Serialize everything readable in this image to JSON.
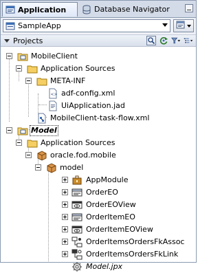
{
  "tabs": [
    {
      "label": "Application",
      "icon": "application-icon",
      "active": true
    },
    {
      "label": "Database Navigator",
      "icon": "database-navigator-icon",
      "active": false
    }
  ],
  "app_selector": {
    "value": "SampleApp",
    "icon": "application-icon"
  },
  "projects_panel": {
    "title": "Projects"
  },
  "tree": [
    {
      "label": "MobileClient",
      "icon": "project-folder-icon",
      "expanded": true
    },
    {
      "label": "Application Sources",
      "icon": "folder-icon",
      "expanded": true
    },
    {
      "label": "META-INF",
      "icon": "folder-icon",
      "expanded": true
    },
    {
      "label": "adf-config.xml",
      "icon": "xml-file-icon"
    },
    {
      "label": "UiApplication.jad",
      "icon": "jad-file-icon"
    },
    {
      "label": "MobileClient-task-flow.xml",
      "icon": "task-flow-icon"
    },
    {
      "label": "Model",
      "icon": "project-folder-icon",
      "expanded": true,
      "selected": true
    },
    {
      "label": "Application Sources",
      "icon": "folder-icon",
      "expanded": true
    },
    {
      "label": "oracle.fod.mobile",
      "icon": "package-icon",
      "expanded": true
    },
    {
      "label": "model",
      "icon": "package-icon",
      "expanded": true
    },
    {
      "label": "AppModule",
      "icon": "application-module-icon",
      "expanded": false
    },
    {
      "label": "OrderEO",
      "icon": "entity-object-icon",
      "expanded": false
    },
    {
      "label": "OrderEOView",
      "icon": "view-object-icon",
      "expanded": false
    },
    {
      "label": "OrderItemEO",
      "icon": "entity-object-icon",
      "expanded": false
    },
    {
      "label": "OrderItemEOView",
      "icon": "view-object-icon",
      "expanded": false
    },
    {
      "label": "OrderItemsOrdersFkAssoc",
      "icon": "association-icon",
      "expanded": false
    },
    {
      "label": "OrderItemsOrdersFkLink",
      "icon": "view-link-icon",
      "expanded": false
    },
    {
      "label": "Model.jpx",
      "icon": "jpx-file-icon",
      "italic": true
    }
  ]
}
